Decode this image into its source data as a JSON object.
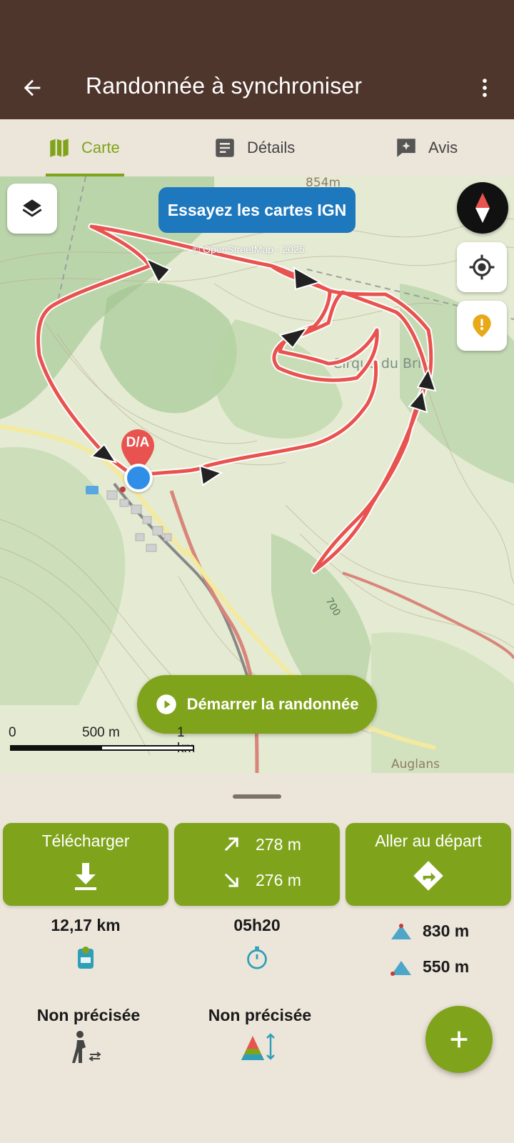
{
  "appbar": {
    "title": "Randonnée à synchroniser"
  },
  "tabs": [
    {
      "label": "Carte",
      "active": true
    },
    {
      "label": "Détails",
      "active": false
    },
    {
      "label": "Avis",
      "active": false
    }
  ],
  "map": {
    "ign_button": "Essayez les cartes IGN",
    "attribution": "© OpenStreetMap - 2025",
    "start_marker": "D/A",
    "labels": {
      "altitude_854": "854m",
      "place": "Cirque du Briis",
      "contour_700": "700",
      "place_bottom": "Auglans"
    },
    "start_button": "Démarrer la randonnée",
    "scale": {
      "zero": "0",
      "mid": "500 m",
      "end": "1 km"
    }
  },
  "sheet": {
    "download": {
      "label": "Télécharger"
    },
    "elevation": {
      "up": "278 m",
      "down": "276 m"
    },
    "go_start": {
      "label": "Aller au départ"
    },
    "distance": "12,17 km",
    "duration": "05h20",
    "alt_max": "830 m",
    "alt_min": "550 m",
    "practice": "Non précisée",
    "difficulty": "Non précisée"
  },
  "colors": {
    "brand_green": "#7fa41b",
    "appbar_brown": "#4f362c",
    "track_red": "#e8534f",
    "ign_blue": "#1e78bd"
  }
}
